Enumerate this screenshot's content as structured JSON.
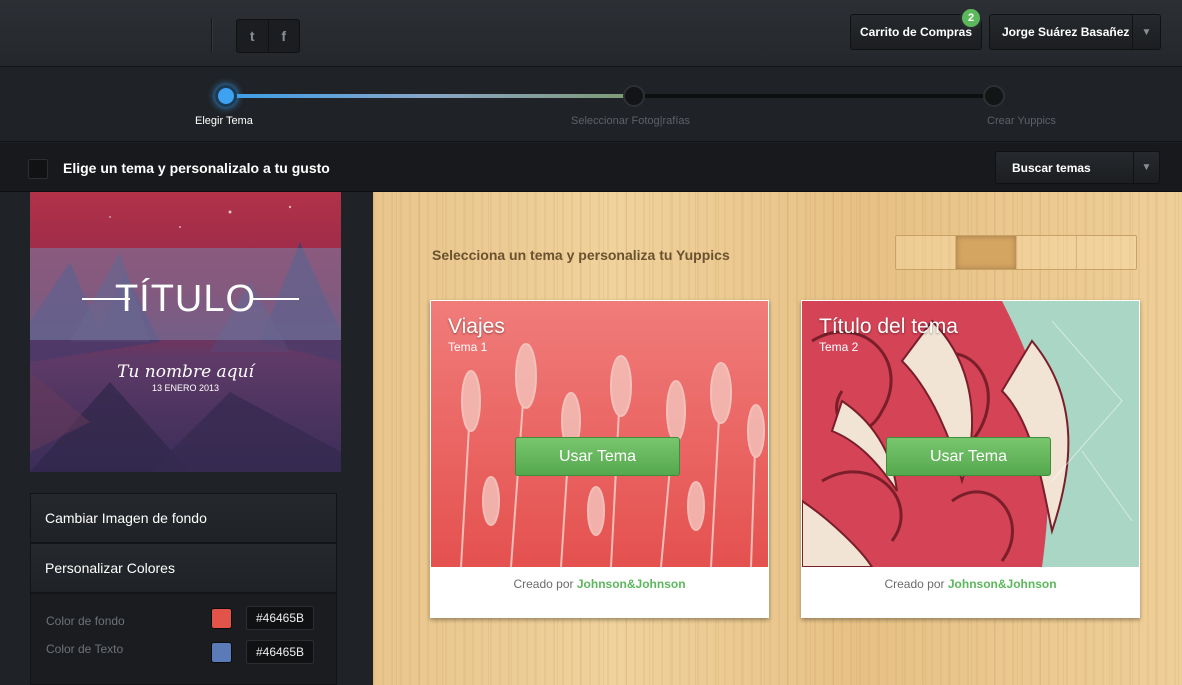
{
  "header": {
    "social": {
      "twitter": "t",
      "facebook": "f"
    },
    "cart": {
      "label": "Carrito de Compras",
      "count": "2"
    },
    "user": {
      "name": "Jorge Suárez Basañez"
    }
  },
  "steps": [
    {
      "label": "Elegir Tema",
      "active": true
    },
    {
      "label": "Seleccionar Fotog|rafías",
      "active": false
    },
    {
      "label": "Crear  Yuppics",
      "active": false
    }
  ],
  "progress": 0.53,
  "subheader": {
    "title": "Elige un tema y personalizalo a tu gusto",
    "search_label": "Buscar temas"
  },
  "preview": {
    "title": "TÍTULO",
    "name": "Tu nombre aquí",
    "date": "13 ENERO 2013"
  },
  "sidebar": {
    "menu": [
      "Cambiar Imagen de fondo",
      "Personalizar Colores"
    ],
    "colors": [
      {
        "label": "Color de fondo",
        "swatch": "#e2534a",
        "value": "#46465B"
      },
      {
        "label": "Color de Texto",
        "swatch": "#5b7bb8",
        "value": "#46465B"
      }
    ]
  },
  "main": {
    "heading": "Selecciona un tema y personaliza tu Yuppics",
    "pager_active": 2,
    "cards": [
      {
        "title": "Viajes",
        "subtitle": "Tema 1",
        "button": "Usar Tema",
        "by": "Creado por",
        "author": "Johnson&Johnson"
      },
      {
        "title": "Título del tema",
        "subtitle": "Tema 2",
        "button": "Usar Tema",
        "by": "Creado por",
        "author": "Johnson&Johnson"
      }
    ]
  },
  "colors": {
    "accent": "#3ea2f0",
    "button_green": "#5cb85c"
  }
}
